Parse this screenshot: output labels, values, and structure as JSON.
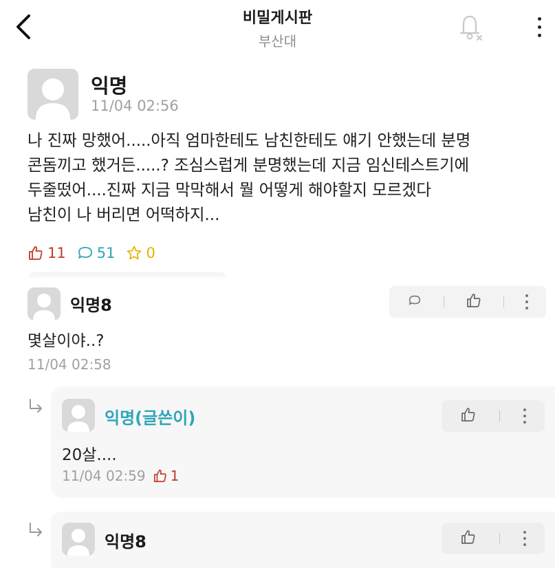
{
  "header": {
    "title": "비밀게시판",
    "subtitle": "부산대"
  },
  "post": {
    "author": "익명",
    "time": "11/04 02:56",
    "body": "나 진짜 망했어.....아직 엄마한테도 남친한테도 얘기 안했는데 분명\n콘돔끼고 했거든.....? 조심스럽게 분명했는데 지금 임신테스트기에\n두줄떴어....진짜 지금 막막해서 뭘 어떻게 해야할지 모르겠다\n남친이 나 버리면 어떡하지...",
    "likes": "11",
    "comments": "51",
    "scraps": "0"
  },
  "comments": [
    {
      "author": "익명8",
      "body": "몇살이야..?",
      "time": "11/04 02:58",
      "replies": [
        {
          "author": "익명(글쓴이)",
          "body": "20살....",
          "time": "11/04 02:59",
          "likes": "1"
        },
        {
          "author": "익명8"
        }
      ]
    }
  ],
  "icons": {
    "back": "chevron-left-icon",
    "notification": "bell-off-icon",
    "more": "more-vertical-icon",
    "like": "thumbs-up-icon",
    "comment": "speech-bubble-icon",
    "scrap": "star-icon",
    "reply": "reply-arrow-icon"
  },
  "colors": {
    "like": "#c0392b",
    "comment": "#2ea5b8",
    "scrap": "#e0b400",
    "author_highlight": "#2ea5b8",
    "muted": "#a0a0a0"
  }
}
